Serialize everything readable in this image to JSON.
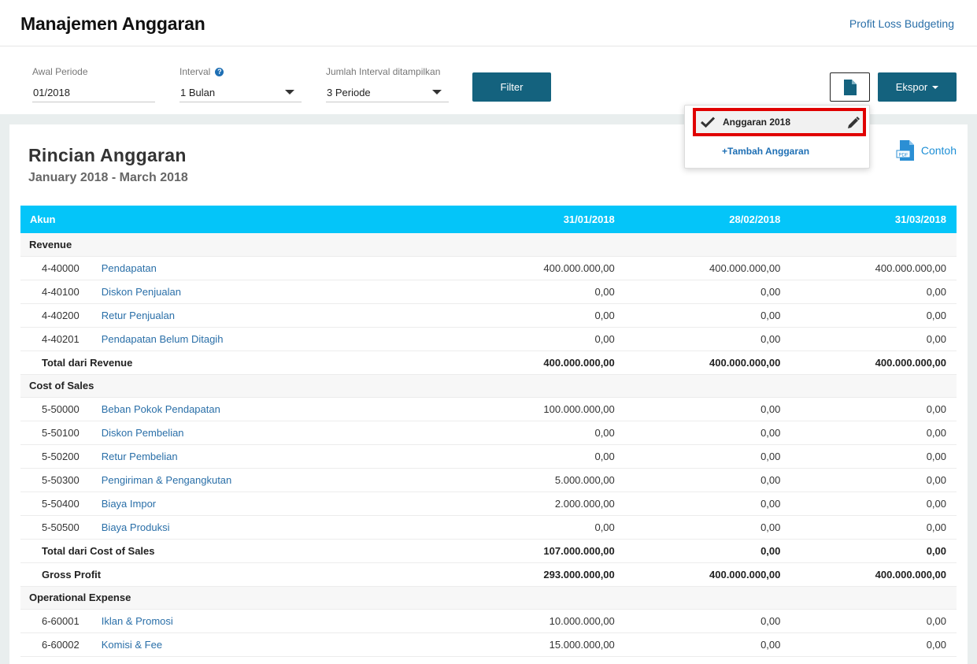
{
  "header": {
    "title": "Manajemen Anggaran",
    "link": "Profit Loss Budgeting"
  },
  "filters": {
    "period_start": {
      "label": "Awal Periode",
      "value": "01/2018"
    },
    "interval": {
      "label": "Interval",
      "value": "1 Bulan"
    },
    "interval_count": {
      "label": "Jumlah Interval ditampilkan",
      "value": "3 Periode"
    },
    "filter_button": "Filter",
    "export_button": "Ekspor"
  },
  "dropdown": {
    "selected": "Anggaran 2018",
    "add": "+Tambah Anggaran"
  },
  "report": {
    "title": "Rincian Anggaran",
    "subtitle": "January 2018 - March 2018",
    "sample_link": "Contoh",
    "pdf_label": "PDF",
    "columns": [
      "Akun",
      "31/01/2018",
      "28/02/2018",
      "31/03/2018"
    ],
    "groups": [
      {
        "name": "Revenue",
        "rows": [
          {
            "code": "4-40000",
            "name": "Pendapatan",
            "values": [
              "400.000.000,00",
              "400.000.000,00",
              "400.000.000,00"
            ]
          },
          {
            "code": "4-40100",
            "name": "Diskon Penjualan",
            "values": [
              "0,00",
              "0,00",
              "0,00"
            ]
          },
          {
            "code": "4-40200",
            "name": "Retur Penjualan",
            "values": [
              "0,00",
              "0,00",
              "0,00"
            ]
          },
          {
            "code": "4-40201",
            "name": "Pendapatan Belum Ditagih",
            "values": [
              "0,00",
              "0,00",
              "0,00"
            ]
          }
        ],
        "total": {
          "label": "Total dari Revenue",
          "values": [
            "400.000.000,00",
            "400.000.000,00",
            "400.000.000,00"
          ]
        }
      },
      {
        "name": "Cost of Sales",
        "rows": [
          {
            "code": "5-50000",
            "name": "Beban Pokok Pendapatan",
            "values": [
              "100.000.000,00",
              "0,00",
              "0,00"
            ]
          },
          {
            "code": "5-50100",
            "name": "Diskon Pembelian",
            "values": [
              "0,00",
              "0,00",
              "0,00"
            ]
          },
          {
            "code": "5-50200",
            "name": "Retur Pembelian",
            "values": [
              "0,00",
              "0,00",
              "0,00"
            ]
          },
          {
            "code": "5-50300",
            "name": "Pengiriman & Pengangkutan",
            "values": [
              "5.000.000,00",
              "0,00",
              "0,00"
            ]
          },
          {
            "code": "5-50400",
            "name": "Biaya Impor",
            "values": [
              "2.000.000,00",
              "0,00",
              "0,00"
            ]
          },
          {
            "code": "5-50500",
            "name": "Biaya Produksi",
            "values": [
              "0,00",
              "0,00",
              "0,00"
            ]
          }
        ],
        "total": {
          "label": "Total dari Cost of Sales",
          "values": [
            "107.000.000,00",
            "0,00",
            "0,00"
          ]
        }
      }
    ],
    "gross_profit": {
      "label": "Gross Profit",
      "values": [
        "293.000.000,00",
        "400.000.000,00",
        "400.000.000,00"
      ]
    },
    "opex": {
      "name": "Operational Expense",
      "rows": [
        {
          "code": "6-60001",
          "name": "Iklan & Promosi",
          "values": [
            "10.000.000,00",
            "0,00",
            "0,00"
          ]
        },
        {
          "code": "6-60002",
          "name": "Komisi & Fee",
          "values": [
            "15.000.000,00",
            "0,00",
            "0,00"
          ]
        }
      ]
    }
  }
}
